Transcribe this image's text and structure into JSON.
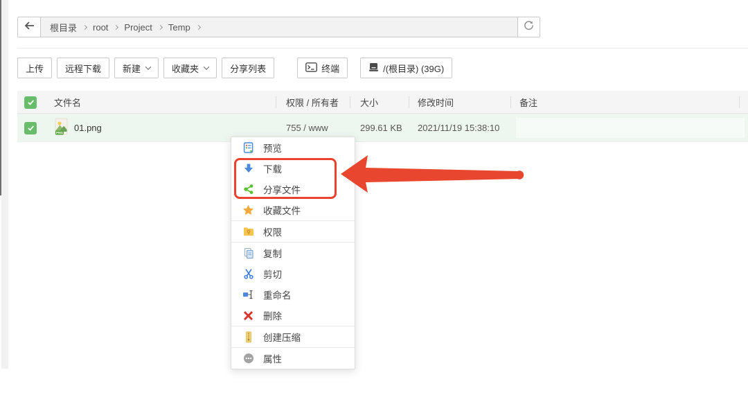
{
  "topbar": {
    "path": [
      "根目录",
      "root",
      "Project",
      "Temp"
    ]
  },
  "toolbar": {
    "upload": "上传",
    "remote_download": "远程下载",
    "new_menu": "新建",
    "favorites": "收藏夹",
    "share_list": "分享列表",
    "terminal": "终端",
    "disk_selector": "/(根目录) (39G)"
  },
  "file_table": {
    "headers": {
      "name": "文件名",
      "perm_owner": "权限 / 所有者",
      "size": "大小",
      "mtime": "修改时间",
      "remark": "备注"
    },
    "rows": [
      {
        "name": "01.png",
        "type_badge": "PNG",
        "perm_owner": "755 / www",
        "size": "299.61 KB",
        "mtime": "2021/11/19 15:38:10",
        "remark": "",
        "selected": true
      }
    ]
  },
  "context_menu": {
    "items": [
      {
        "label": "预览",
        "icon": "preview-icon"
      },
      {
        "label": "下载",
        "icon": "download-icon",
        "highlighted": true
      },
      {
        "label": "分享文件",
        "icon": "share-icon",
        "highlighted": true
      },
      {
        "label": "收藏文件",
        "icon": "star-icon"
      },
      {
        "label": "权限",
        "icon": "permission-icon"
      },
      {
        "label": "复制",
        "icon": "copy-icon"
      },
      {
        "label": "剪切",
        "icon": "cut-icon"
      },
      {
        "label": "重命名",
        "icon": "rename-icon"
      },
      {
        "label": "删除",
        "icon": "delete-icon"
      },
      {
        "label": "创建压缩",
        "icon": "zip-icon"
      },
      {
        "label": "属性",
        "icon": "properties-icon"
      }
    ]
  },
  "annotation": {
    "highlighted_items": [
      "下载",
      "分享文件"
    ],
    "highlight_color": "#e8432c"
  }
}
